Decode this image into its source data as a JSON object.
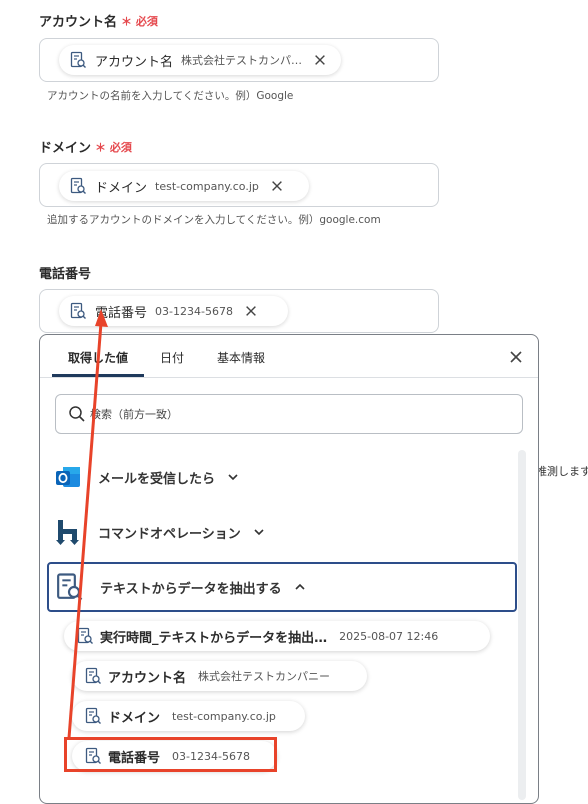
{
  "fields": [
    {
      "label": "アカウント名",
      "required_mark": "＊",
      "required_text": "必須",
      "chip_name": "アカウント名",
      "chip_value": "株式会社テストカンパ…",
      "hint": "アカウントの名前を入力してください。例）Google"
    },
    {
      "label": "ドメイン",
      "required_mark": "＊",
      "required_text": "必須",
      "chip_name": "ドメイン",
      "chip_value": "test-company.co.jp",
      "hint": "追加するアカウントのドメインを入力してください。例）google.com"
    },
    {
      "label": "電話番号",
      "chip_name": "電話番号",
      "chip_value": "03-1234-5678"
    }
  ],
  "panel": {
    "tabs": [
      "取得した値",
      "日付",
      "基本情報"
    ],
    "active_tab": 0,
    "search_placeholder": "検索（前方一致）",
    "groups": [
      {
        "label": "メールを受信したら",
        "icon": "outlook-icon",
        "expanded": false
      },
      {
        "label": "コマンドオペレーション",
        "icon": "hubspot-like-icon",
        "expanded": false
      },
      {
        "label": "テキストからデータを抽出する",
        "icon": "extract-doc-icon",
        "expanded": true
      }
    ],
    "items": [
      {
        "name": "実行時間_テキストからデータを抽出…",
        "value": "2025-08-07 12:46"
      },
      {
        "name": "アカウント名",
        "value": "株式会社テストカンパニー"
      },
      {
        "name": "ドメイン",
        "value": "test-company.co.jp"
      },
      {
        "name": "電話番号",
        "value": "03-1234-5678",
        "highlighted": true
      }
    ]
  },
  "background_text": "推測します",
  "colors": {
    "required": "#e5484d",
    "highlight": "#e8432a",
    "active_group_border": "#2d4e8a",
    "tab_underline": "#1f3a5c"
  }
}
